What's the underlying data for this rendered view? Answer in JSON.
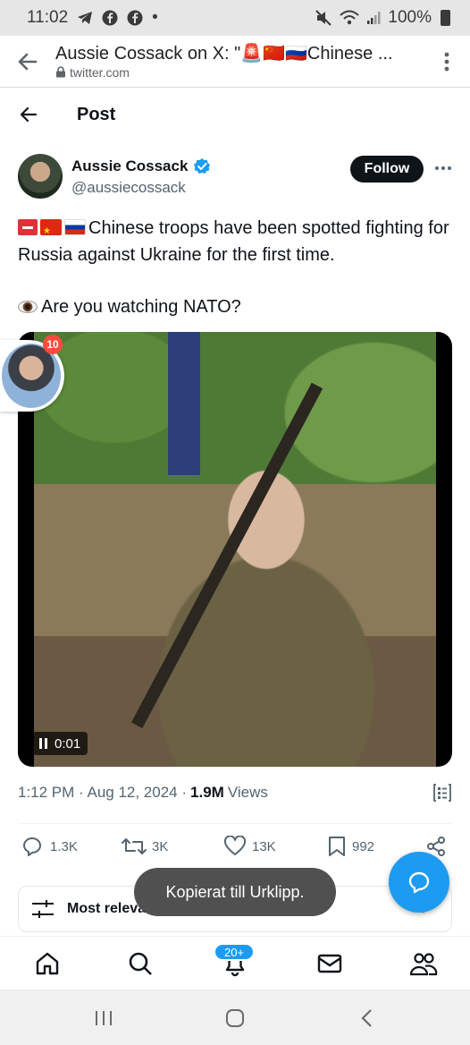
{
  "status_bar": {
    "time": "11:02",
    "dot": "•",
    "battery": "100%"
  },
  "browser": {
    "title": "Aussie Cossack on X: \"🚨🇨🇳🇷🇺Chinese ...",
    "url": "twitter.com"
  },
  "header": {
    "title": "Post"
  },
  "author": {
    "name": "Aussie Cossack",
    "handle": "@aussiecossack",
    "follow_label": "Follow"
  },
  "tweet": {
    "line1": "Chinese troops have been spotted fighting for Russia against Ukraine for the first time.",
    "line2": "Are you watching NATO?"
  },
  "video": {
    "time": "0:01"
  },
  "overlay": {
    "badge": "10"
  },
  "meta": {
    "time_date": "1:12 PM · Aug 12, 2024 ·",
    "views_count": "1.9M",
    "views_label": "Views"
  },
  "actions": {
    "replies": "1.3K",
    "reposts": "3K",
    "likes": "13K",
    "bookmarks": "992"
  },
  "sort": {
    "label": "Most relevant"
  },
  "toast": {
    "text": "Kopierat till Urklipp."
  },
  "nav": {
    "notifications_badge": "20+"
  },
  "colors": {
    "accent": "#1d9bf0",
    "text": "#0f1419",
    "muted": "#536471",
    "toast_bg": "#505050"
  }
}
